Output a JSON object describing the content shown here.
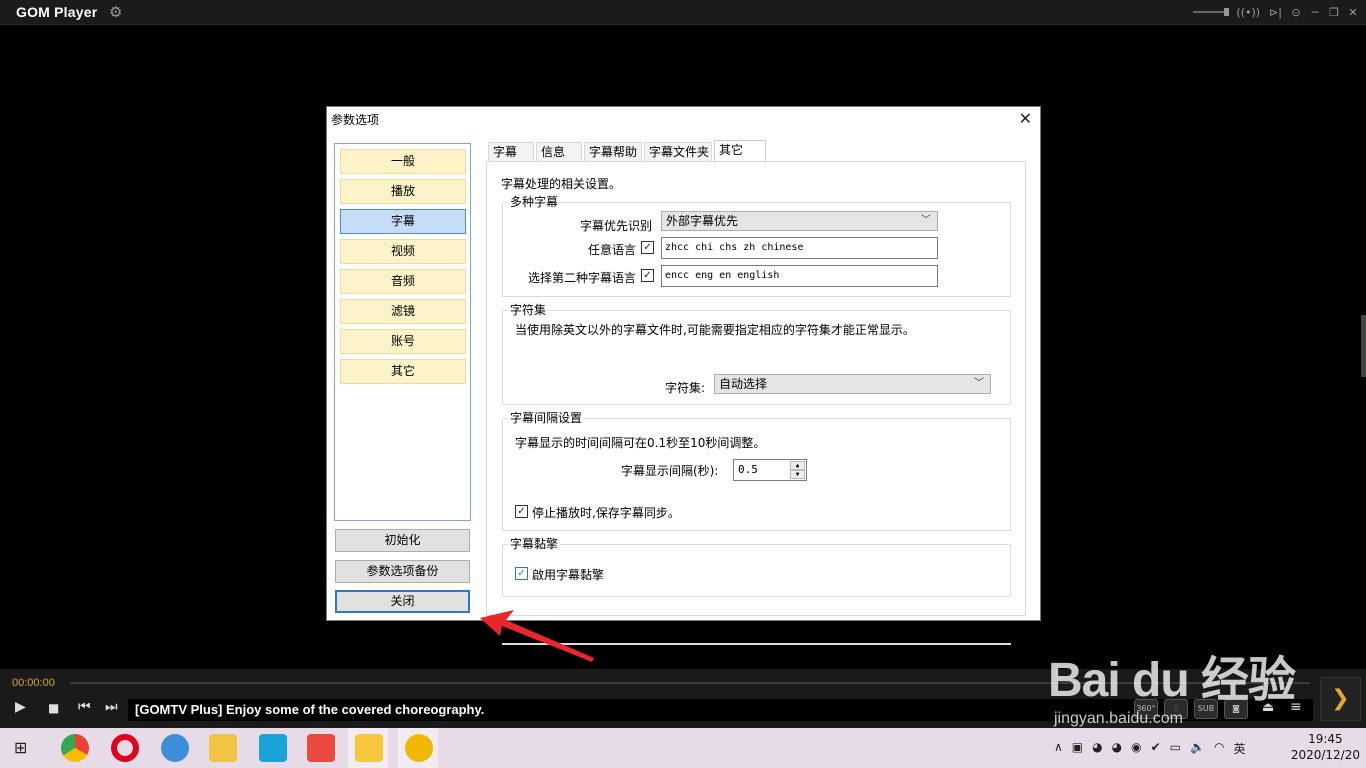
{
  "player": {
    "name": "GOM Player",
    "time": "00:00:00",
    "ticker": "[GOMTV Plus] Enjoy some of the covered choreography.",
    "tools": [
      "360°",
      "",
      "SUB",
      ""
    ]
  },
  "dialog": {
    "title": "参数选项",
    "nav": [
      "一般",
      "播放",
      "字幕",
      "视频",
      "音频",
      "滤镜",
      "账号",
      "其它"
    ],
    "active_nav": "字幕",
    "buttons": {
      "reset": "初始化",
      "backup": "参数选项备份",
      "close": "关闭"
    },
    "tabs": [
      "字幕",
      "信息",
      "字幕帮助",
      "字幕文件夹",
      "其它"
    ],
    "active_tab": "其它",
    "intro": "字幕处理的相关设置。",
    "multi": {
      "title": "多种字幕",
      "priority_label": "字幕优先识别",
      "priority_value": "外部字幕优先",
      "any_lang_label": "任意语言",
      "any_lang_value": "zhcc chi chs zh chinese",
      "second_lang_label": "选择第二种字幕语言",
      "second_lang_value": "encc eng en english"
    },
    "charset": {
      "title": "字符集",
      "desc": "当使用除英文以外的字幕文件时,可能需要指定相应的字符集才能正常显示。",
      "label": "字符集:",
      "value": "自动选择"
    },
    "interval": {
      "title": "字幕间隔设置",
      "desc": "字幕显示的时间间隔可在0.1秒至10秒间调整。",
      "label": "字幕显示间隔(秒):",
      "value": "0.5",
      "sync_label": "停止播放时,保存字幕同步。",
      "sync_checked": true
    },
    "punct": {
      "title": "字幕黏擎",
      "enable_label": "啟用字幕黏擎",
      "enable_checked": true
    }
  },
  "watermark": {
    "brand": "Bai du 经验",
    "url": "jingyan.baidu.com"
  },
  "taskbar": {
    "ime": "英",
    "time": "19:45",
    "date": "2020/12/20"
  },
  "colors": {
    "accent": "#d6a81e",
    "annotation": "#e8262b",
    "nav_active": "#c7dcf7",
    "nav_item": "#fdf3c8"
  }
}
